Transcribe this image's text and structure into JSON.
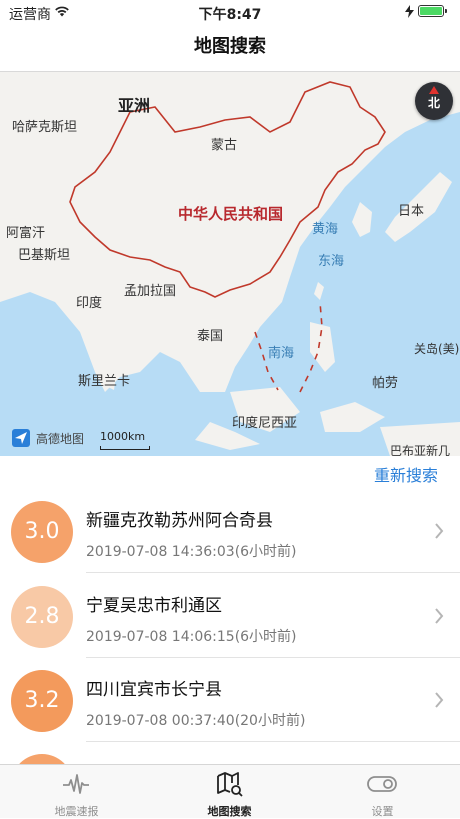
{
  "status_bar": {
    "carrier": "运营商",
    "time": "下午8:47"
  },
  "nav": {
    "title": "地图搜索"
  },
  "map": {
    "labels": {
      "asia": "亚洲",
      "kazakhstan": "哈萨克斯坦",
      "mongolia": "蒙古",
      "china": "中华人民共和国",
      "japan": "日本",
      "afghanistan": "阿富汗",
      "pakistan": "巴基斯坦",
      "yellow_sea": "黄海",
      "east_sea": "东海",
      "india": "印度",
      "bangladesh": "孟加拉国",
      "thailand": "泰国",
      "south_sea": "南海",
      "guam": "关岛(美)",
      "sri_lanka": "斯里兰卡",
      "palau": "帕劳",
      "indonesia": "印度尼西亚",
      "png": "巴布亚新几"
    },
    "attribution": "高德地图",
    "scale": "1000km",
    "compass": "北"
  },
  "refresh_label": "重新搜索",
  "quakes": [
    {
      "magnitude": "3.0",
      "place": "新疆克孜勒苏州阿合奇县",
      "time": "2019-07-08 14:36:03(6小时前)",
      "color": "#f5a26a"
    },
    {
      "magnitude": "2.8",
      "place": "宁夏吴忠市利通区",
      "time": "2019-07-08 14:06:15(6小时前)",
      "color": "#f8c9a6"
    },
    {
      "magnitude": "3.2",
      "place": "四川宜宾市长宁县",
      "time": "2019-07-08 00:37:40(20小时前)",
      "color": "#f39a5c"
    },
    {
      "magnitude": "",
      "place": "",
      "time": "",
      "color": "#f5a26a"
    }
  ],
  "tabs": [
    {
      "label": "地震速报",
      "icon": "waveform-icon"
    },
    {
      "label": "地图搜索",
      "icon": "map-search-icon",
      "active": true
    },
    {
      "label": "设置",
      "icon": "toggle-icon"
    }
  ]
}
